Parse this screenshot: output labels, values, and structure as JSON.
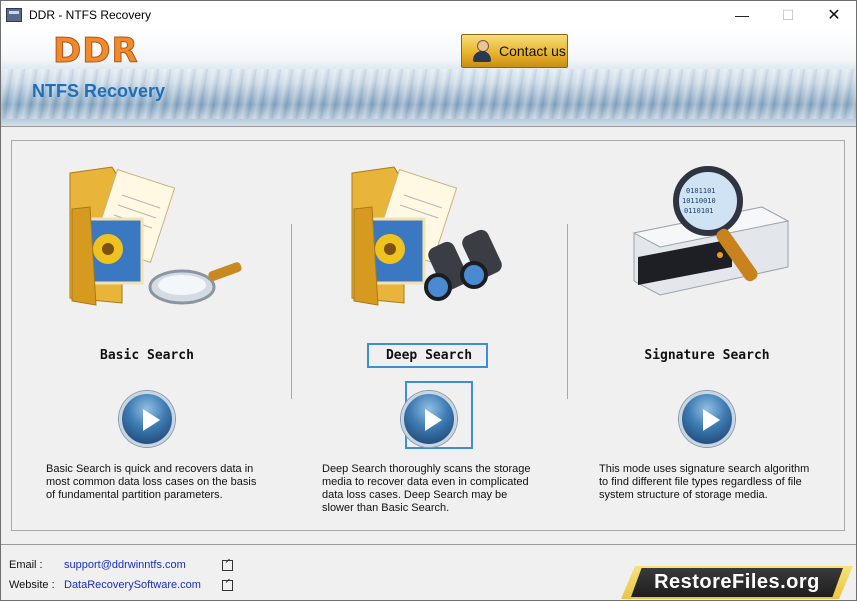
{
  "window": {
    "title": "DDR - NTFS Recovery"
  },
  "header": {
    "logo": "DDR",
    "product": "NTFS Recovery",
    "contact_label": "Contact us"
  },
  "options": [
    {
      "title": "Basic Search",
      "description": "Basic Search is quick and recovers data in most common data loss cases on the basis of fundamental partition parameters."
    },
    {
      "title": "Deep Search",
      "description": "Deep Search thoroughly scans the storage media to recover data even in complicated data loss cases. Deep Search may be slower than Basic Search."
    },
    {
      "title": "Signature Search",
      "description": "This mode uses signature search algorithm to find different file types regardless of file system structure of storage media."
    }
  ],
  "footer": {
    "email_label": "Email :",
    "email": "support@ddrwinntfs.com",
    "website_label": "Website :",
    "website": "DataRecoverySoftware.com",
    "brand": "RestoreFiles.org"
  },
  "colors": {
    "accent": "#3b8fd9",
    "logo": "#f08a2a",
    "link": "#1a2fb8"
  }
}
